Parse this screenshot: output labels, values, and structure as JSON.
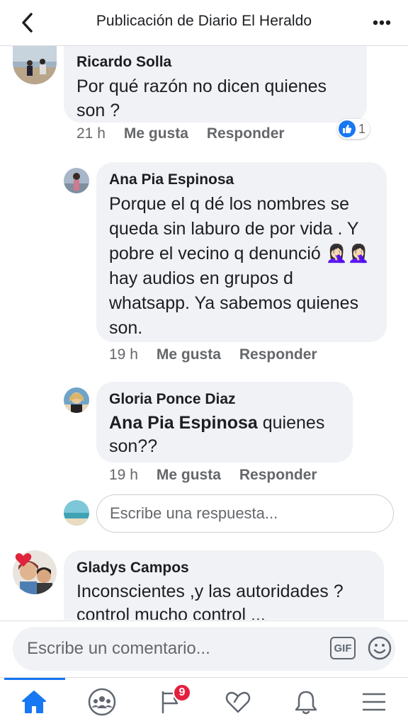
{
  "header": {
    "title": "Publicación de Diario El Heraldo",
    "back_icon": "chevron-left-icon",
    "more_icon": "more-horizontal-icon"
  },
  "comments": [
    {
      "author": "Ricardo Solla",
      "text": "Por qué razón no dicen quienes son ?",
      "time": "21 h",
      "like_label": "Me gusta",
      "reply_label": "Responder",
      "reaction_count": "1"
    },
    {
      "author": "Ana Pia Espinosa",
      "text_before": "Porque el q dé los nombres se queda sin laburo de por vida . Y pobre el vecino q denunció",
      "emoji": "🤦🏻‍♀️🤦🏻‍♀️",
      "text_after": " hay audios en grupos d whatsapp. Ya sabemos quienes son.",
      "time": "19 h",
      "like_label": "Me gusta",
      "reply_label": "Responder"
    },
    {
      "author": "Gloria Ponce Diaz",
      "mention": "Ana Pia Espinosa",
      "text": " quienes son??",
      "time": "19 h",
      "like_label": "Me gusta",
      "reply_label": "Responder"
    },
    {
      "author": "Gladys Campos",
      "text": "Inconscientes ,y las autoridades ? control mucho control ..."
    }
  ],
  "reply_input": {
    "placeholder": "Escribe una respuesta..."
  },
  "composer": {
    "placeholder": "Escribe un comentario...",
    "gif_label": "GIF",
    "emoji_icon": "smiley-icon"
  },
  "tabbar": {
    "items": [
      {
        "name": "home",
        "icon": "home-icon",
        "active": true
      },
      {
        "name": "groups",
        "icon": "groups-icon"
      },
      {
        "name": "pages",
        "icon": "flag-icon",
        "badge": "9"
      },
      {
        "name": "dating",
        "icon": "heart-icon"
      },
      {
        "name": "notifications",
        "icon": "bell-icon"
      },
      {
        "name": "menu",
        "icon": "hamburger-menu-icon"
      }
    ]
  },
  "colors": {
    "accent": "#1877f2",
    "bubble": "#f0f2f5",
    "secondary_text": "#65676b",
    "badge": "#e41e3f"
  }
}
